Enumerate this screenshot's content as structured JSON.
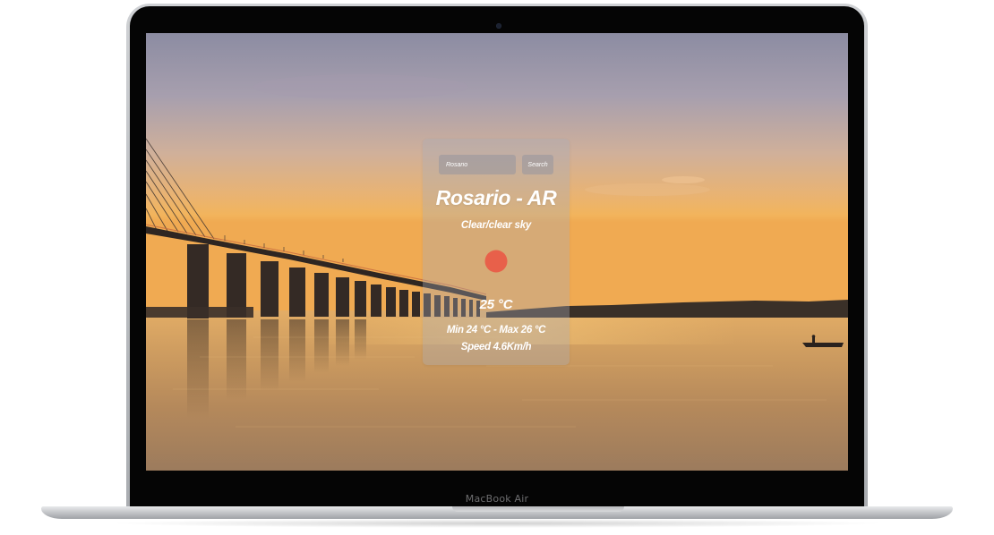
{
  "device": {
    "brand_label": "MacBook Air"
  },
  "weather_app": {
    "search": {
      "input_value": "Rosario",
      "button_label": "Search"
    },
    "location": "Rosario - AR",
    "description": "Clear/clear sky",
    "icon": "clear-sky-sun-icon",
    "temperature": "25 °C",
    "min_max": "Min 24 °C - Max 26 °C",
    "wind_speed": "Speed 4.6Km/h",
    "colors": {
      "sun": "#e8604a",
      "card": "#aaacb8",
      "text": "#ffffff"
    }
  },
  "background": {
    "scene": "sunset-river-bridge",
    "colors": {
      "sky_top": "#8f8fa3",
      "sky_horizon": "#efb35e",
      "water": "#c99a5c"
    }
  }
}
